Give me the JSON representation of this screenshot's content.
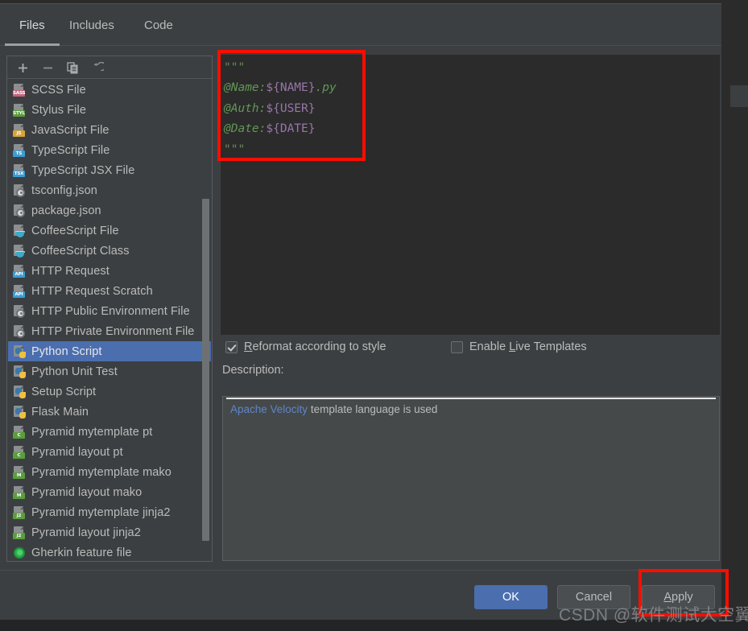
{
  "dialog": {
    "tabs": [
      {
        "label": "Files",
        "active": true
      },
      {
        "label": "Includes",
        "active": false
      },
      {
        "label": "Code",
        "active": false
      }
    ],
    "toolbar": {
      "add_tooltip": "Add",
      "remove_tooltip": "Remove",
      "copy_tooltip": "Copy",
      "revert_tooltip": "Reset to Default",
      "icons": [
        "plus-icon",
        "minus-icon",
        "copy-icon",
        "revert-icon"
      ]
    },
    "file_list": {
      "selected": "Python Script",
      "items": [
        {
          "label": "SCSS File",
          "icon": "sass-file-icon",
          "badge": "SASS",
          "badge_color": "#c3647f",
          "style": "badge"
        },
        {
          "label": "Stylus File",
          "icon": "stylus-file-icon",
          "badge": "STYL",
          "badge_color": "#5a9e3c",
          "style": "badge"
        },
        {
          "label": "JavaScript File",
          "icon": "javascript-file-icon",
          "badge": "JS",
          "badge_color": "#d7a43a",
          "style": "badge"
        },
        {
          "label": "TypeScript File",
          "icon": "typescript-file-icon",
          "badge": "TS",
          "badge_color": "#3c9cd4",
          "style": "badge"
        },
        {
          "label": "TypeScript JSX File",
          "icon": "typescript-jsx-file-icon",
          "badge": "TSX",
          "badge_color": "#3c9cd4",
          "style": "badge"
        },
        {
          "label": "tsconfig.json",
          "icon": "tsconfig-json-icon",
          "badge": "",
          "badge_color": "",
          "style": "gear"
        },
        {
          "label": "package.json",
          "icon": "package-json-icon",
          "badge": "",
          "badge_color": "",
          "style": "gear"
        },
        {
          "label": "CoffeeScript File",
          "icon": "coffeescript-file-icon",
          "badge": "",
          "badge_color": "",
          "style": "coffee"
        },
        {
          "label": "CoffeeScript Class",
          "icon": "coffeescript-class-icon",
          "badge": "",
          "badge_color": "",
          "style": "coffee"
        },
        {
          "label": "HTTP Request",
          "icon": "http-request-icon",
          "badge": "API",
          "badge_color": "#3c9cd4",
          "style": "badge"
        },
        {
          "label": "HTTP Request Scratch",
          "icon": "http-request-scratch-icon",
          "badge": "API",
          "badge_color": "#3c9cd4",
          "style": "badge"
        },
        {
          "label": "HTTP Public Environment File",
          "icon": "http-public-environment-file-icon",
          "badge": "",
          "badge_color": "",
          "style": "gear"
        },
        {
          "label": "HTTP Private Environment File",
          "icon": "http-private-environment-file-icon",
          "badge": "",
          "badge_color": "",
          "style": "gear"
        },
        {
          "label": "Python Script",
          "icon": "python-script-icon",
          "badge": "",
          "badge_color": "",
          "style": "python"
        },
        {
          "label": "Python Unit Test",
          "icon": "python-unit-test-icon",
          "badge": "",
          "badge_color": "",
          "style": "python"
        },
        {
          "label": "Setup Script",
          "icon": "setup-script-icon",
          "badge": "",
          "badge_color": "",
          "style": "python"
        },
        {
          "label": "Flask Main",
          "icon": "flask-main-icon",
          "badge": "",
          "badge_color": "",
          "style": "python"
        },
        {
          "label": "Pyramid mytemplate pt",
          "icon": "pyramid-mytemplate-pt-icon",
          "badge": "C",
          "badge_color": "#5a9e3c",
          "style": "badge"
        },
        {
          "label": "Pyramid layout pt",
          "icon": "pyramid-layout-pt-icon",
          "badge": "C",
          "badge_color": "#5a9e3c",
          "style": "badge"
        },
        {
          "label": "Pyramid mytemplate mako",
          "icon": "pyramid-mytemplate-mako-icon",
          "badge": "M",
          "badge_color": "#5a9e3c",
          "style": "badge"
        },
        {
          "label": "Pyramid layout mako",
          "icon": "pyramid-layout-mako-icon",
          "badge": "M",
          "badge_color": "#5a9e3c",
          "style": "badge"
        },
        {
          "label": "Pyramid mytemplate jinja2",
          "icon": "pyramid-mytemplate-jinja2-icon",
          "badge": "J2",
          "badge_color": "#5a9e3c",
          "style": "badge"
        },
        {
          "label": "Pyramid layout jinja2",
          "icon": "pyramid-layout-jinja2-icon",
          "badge": "J2",
          "badge_color": "#5a9e3c",
          "style": "badge"
        },
        {
          "label": "Gherkin feature file",
          "icon": "gherkin-feature-file-icon",
          "badge": "",
          "badge_color": "",
          "style": "gherkin"
        }
      ]
    },
    "editor": {
      "lines": [
        [
          {
            "t": "\"\"\"",
            "c": "tok-str"
          }
        ],
        [
          {
            "t": "@Name:",
            "c": "tok-cmt"
          },
          {
            "t": "${NAME}",
            "c": "tok-var"
          },
          {
            "t": ".py",
            "c": "tok-cmt"
          }
        ],
        [
          {
            "t": "@Auth:",
            "c": "tok-cmt"
          },
          {
            "t": "${USER}",
            "c": "tok-var"
          }
        ],
        [
          {
            "t": "@Date:",
            "c": "tok-cmt"
          },
          {
            "t": "${DATE}",
            "c": "tok-var"
          }
        ],
        [
          {
            "t": "\"\"\"",
            "c": "tok-str"
          }
        ]
      ]
    },
    "options": {
      "reformat": {
        "label": "Reformat according to style",
        "mnemonic": "R",
        "checked": true
      },
      "live_templates": {
        "label": "Enable Live Templates",
        "mnemonic": "L",
        "checked": false
      }
    },
    "description": {
      "title": "Description:",
      "link_text": "Apache Velocity",
      "rest_text": " template language is used"
    },
    "buttons": {
      "ok": "OK",
      "cancel": "Cancel",
      "apply": "Apply",
      "apply_mnemonic": "A"
    }
  },
  "annotations": {
    "color": "#fb0d00",
    "boxes": [
      "code-template-highlight",
      "apply-button-highlight"
    ]
  },
  "watermark": "CSDN @软件测试大空翼"
}
